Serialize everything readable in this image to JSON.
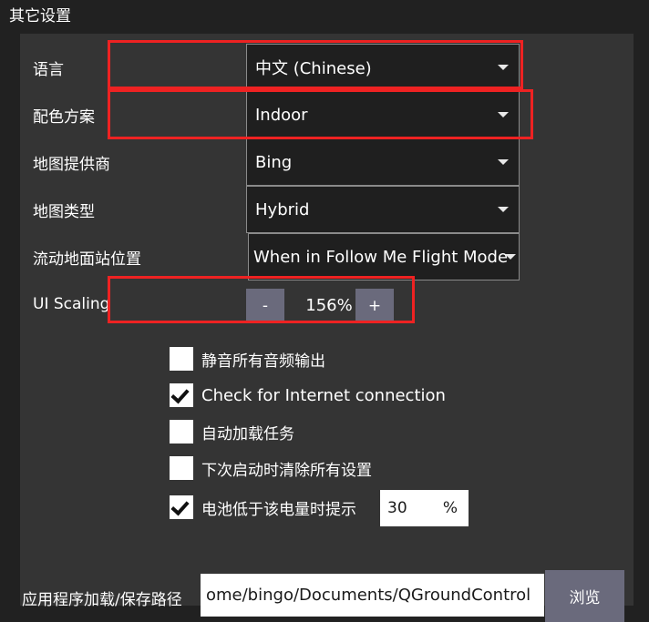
{
  "header": {
    "title": "其它设置"
  },
  "settings_rows": [
    {
      "label": "语言",
      "value": "中文 (Chinese)",
      "highlighted": true
    },
    {
      "label": "配色方案",
      "value": "Indoor",
      "highlighted": true
    },
    {
      "label": "地图提供商",
      "value": "Bing",
      "highlighted": false
    },
    {
      "label": "地图类型",
      "value": "Hybrid",
      "highlighted": false
    },
    {
      "label": "流动地面站位置",
      "value": "When in Follow Me Flight Mode",
      "highlighted": false
    }
  ],
  "ui_scaling": {
    "label": "UI Scaling",
    "decrease_label": "-",
    "increase_label": "+",
    "value": "156%",
    "highlighted": true
  },
  "checkboxes": [
    {
      "label": "静音所有音频输出",
      "checked": false
    },
    {
      "label": "Check for Internet connection",
      "checked": true
    },
    {
      "label": "自动加载任务",
      "checked": false
    },
    {
      "label": "下次启动时清除所有设置",
      "checked": false
    },
    {
      "label": "电池低于该电量时提示",
      "checked": true
    }
  ],
  "battery_field": {
    "value": "30",
    "suffix": "%"
  },
  "save_path": {
    "label": "应用程序加载/保存路径",
    "value": "ome/bingo/Documents/QGroundControl",
    "browse_label": "浏览"
  },
  "colors": {
    "window_background": "#212121",
    "panel_background": "#343434",
    "highlight": "#ee2222",
    "combo_background": "#1f1f1f",
    "button_background": "#6a6a7c",
    "text": "#ffffff"
  }
}
